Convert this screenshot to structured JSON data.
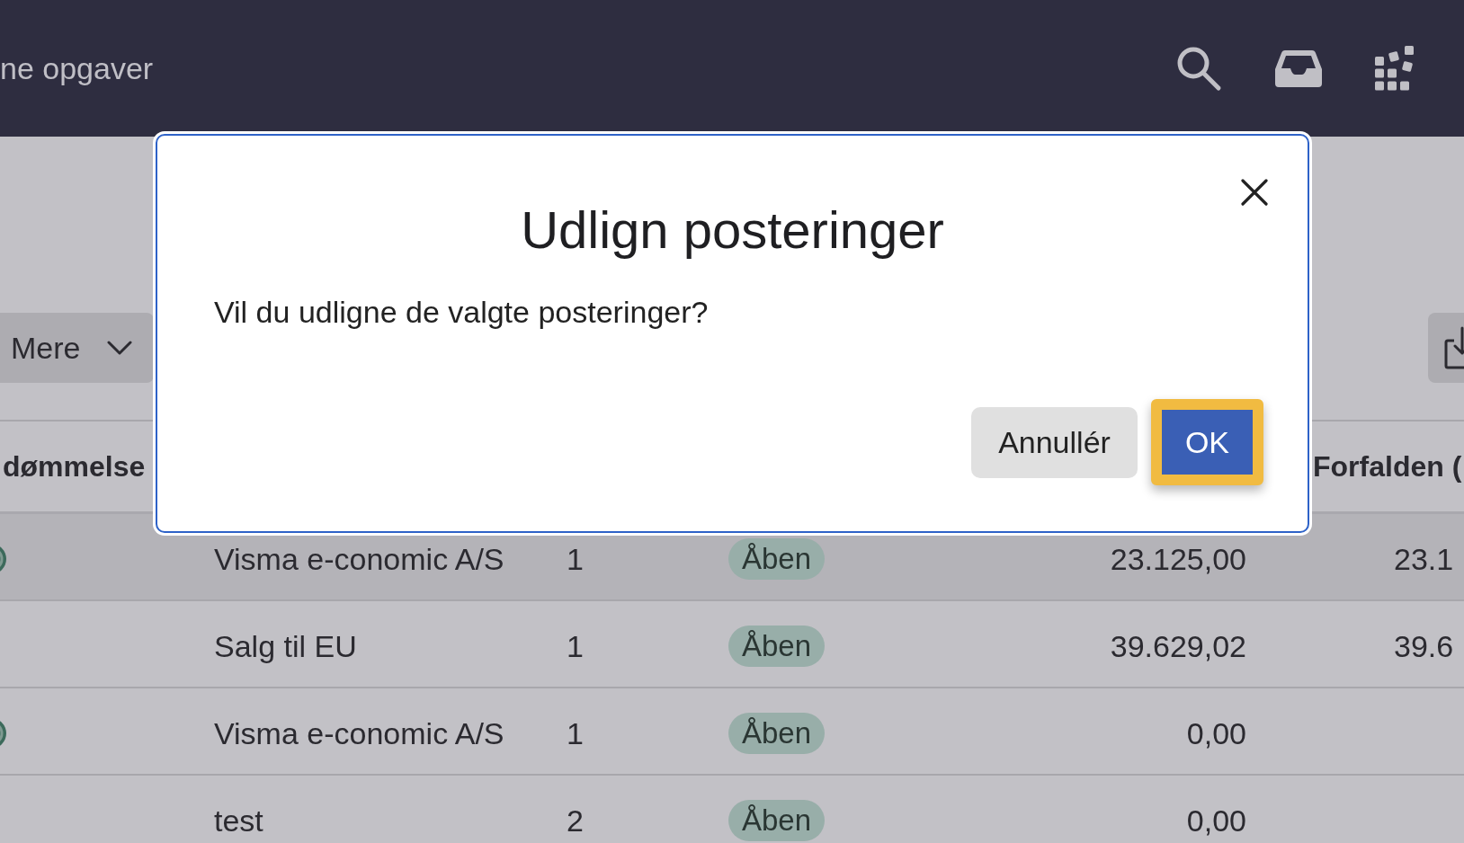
{
  "top_bar": {
    "nav_link": "ne opgaver"
  },
  "toolbar": {
    "more_button": "Mere"
  },
  "table": {
    "columns": {
      "column_1": "dømmelse",
      "column_6": "Forfalden ("
    },
    "rows": [
      {
        "indicator": true,
        "highlighted": true,
        "name": "Visma e-conomic A/S",
        "count": "1",
        "status": "Åben",
        "amount": "23.125,00",
        "due": "23.1"
      },
      {
        "indicator": false,
        "highlighted": false,
        "name": "Salg til EU",
        "count": "1",
        "status": "Åben",
        "amount": "39.629,02",
        "due": "39.6"
      },
      {
        "indicator": true,
        "highlighted": false,
        "name": "Visma e-conomic A/S",
        "count": "1",
        "status": "Åben",
        "amount": "0,00"
      },
      {
        "indicator": false,
        "highlighted": false,
        "name": "test",
        "count": "2",
        "status": "Åben",
        "amount": "0,00"
      }
    ]
  },
  "dialog": {
    "title": "Udlign posteringer",
    "message": "Vil du udligne de valgte posteringer?",
    "buttons": [
      {
        "label": "Annullér",
        "kind": "secondary",
        "focused": false
      },
      {
        "label": "OK",
        "kind": "primary",
        "focused": true
      }
    ]
  }
}
